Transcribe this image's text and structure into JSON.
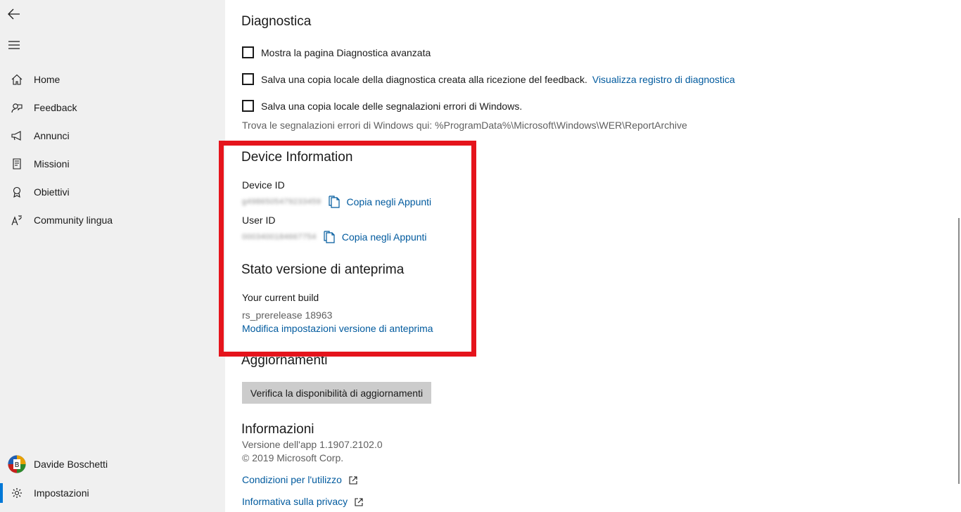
{
  "sidebar": {
    "back_icon": "back-arrow-icon",
    "menu_icon": "hamburger-icon",
    "items": [
      {
        "label": "Home",
        "icon": "home-icon"
      },
      {
        "label": "Feedback",
        "icon": "feedback-icon"
      },
      {
        "label": "Annunci",
        "icon": "megaphone-icon"
      },
      {
        "label": "Missioni",
        "icon": "quest-icon"
      },
      {
        "label": "Obiettivi",
        "icon": "medal-icon"
      },
      {
        "label": "Community lingua",
        "icon": "language-icon"
      }
    ],
    "user_name": "Davide Boschetti",
    "settings_label": "Impostazioni",
    "accent_color": "#0078d7"
  },
  "diagnostics": {
    "title": "Diagnostica",
    "options": [
      {
        "label": "Mostra la pagina Diagnostica avanzata",
        "checked": false
      },
      {
        "label": "Salva una copia locale della diagnostica creata alla ricezione del feedback.",
        "link": "Visualizza registro di diagnostica",
        "checked": false
      },
      {
        "label": "Salva una copia locale delle segnalazioni errori di Windows.",
        "checked": false
      }
    ],
    "note": "Trova le segnalazioni errori di Windows qui: %ProgramData%\\Microsoft\\Windows\\WER\\ReportArchive"
  },
  "device": {
    "title": "Device Information",
    "device_id_label": "Device ID",
    "device_id_value": "g4986505479233459",
    "user_id_label": "User ID",
    "user_id_value": "0003400184667754",
    "copy_label": "Copia negli Appunti"
  },
  "preview": {
    "title": "Stato versione di anteprima",
    "current_build_label": "Your current build",
    "current_build_value": "rs_prerelease 18963",
    "modify_link": "Modifica impostazioni versione di anteprima"
  },
  "updates": {
    "title": "Aggiornamenti",
    "check_button": "Verifica la disponibilità di aggiornamenti"
  },
  "info": {
    "title": "Informazioni",
    "app_version": "Versione dell'app 1.1907.2102.0",
    "copyright": "© 2019 Microsoft Corp.",
    "terms_link": "Condizioni per l'utilizzo",
    "privacy_link": "Informativa sulla privacy"
  },
  "highlight_color": "#e5141c"
}
